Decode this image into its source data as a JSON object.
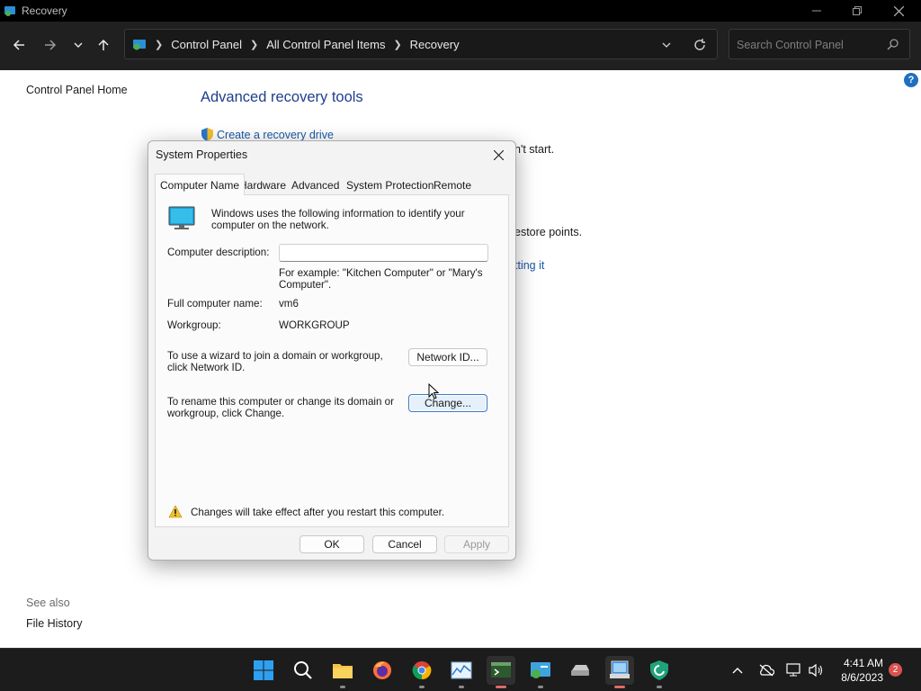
{
  "window": {
    "title": "Recovery"
  },
  "nav": {
    "breadcrumbs": [
      "Control Panel",
      "All Control Panel Items",
      "Recovery"
    ],
    "search_placeholder": "Search Control Panel"
  },
  "left": {
    "home_link": "Control Panel Home",
    "see_also": "See also",
    "file_history": "File History"
  },
  "main": {
    "heading": "Advanced recovery tools",
    "create_drive_link": "Create a recovery drive",
    "fragment1": "n't start.",
    "fragment2": "estore points.",
    "fragment3": "tting it"
  },
  "dialog": {
    "title": "System Properties",
    "tabs": [
      "Computer Name",
      "Hardware",
      "Advanced",
      "System Protection",
      "Remote"
    ],
    "active_tab": "Computer Name",
    "intro": "Windows uses the following information to identify your computer on the network.",
    "desc_label": "Computer description:",
    "desc_value": "",
    "example": "For example: \"Kitchen Computer\" or \"Mary's Computer\".",
    "full_name_label": "Full computer name:",
    "full_name_value": "vm6",
    "workgroup_label": "Workgroup:",
    "workgroup_value": "WORKGROUP",
    "network_id_text": "To use a wizard to join a domain or workgroup, click Network ID.",
    "network_id_button": "Network ID...",
    "change_text": "To rename this computer or change its domain or workgroup, click Change.",
    "change_button": "Change...",
    "warning": "Changes will take effect after you restart this computer.",
    "ok": "OK",
    "cancel": "Cancel",
    "apply": "Apply"
  },
  "taskbar": {
    "apps": [
      "start",
      "search",
      "file-explorer",
      "firefox",
      "chrome",
      "task-manager",
      "terminal",
      "control-panel",
      "drive",
      "system-properties",
      "shield-app"
    ],
    "time": "4:41 AM",
    "date": "8/6/2023",
    "notification_count": "2"
  }
}
